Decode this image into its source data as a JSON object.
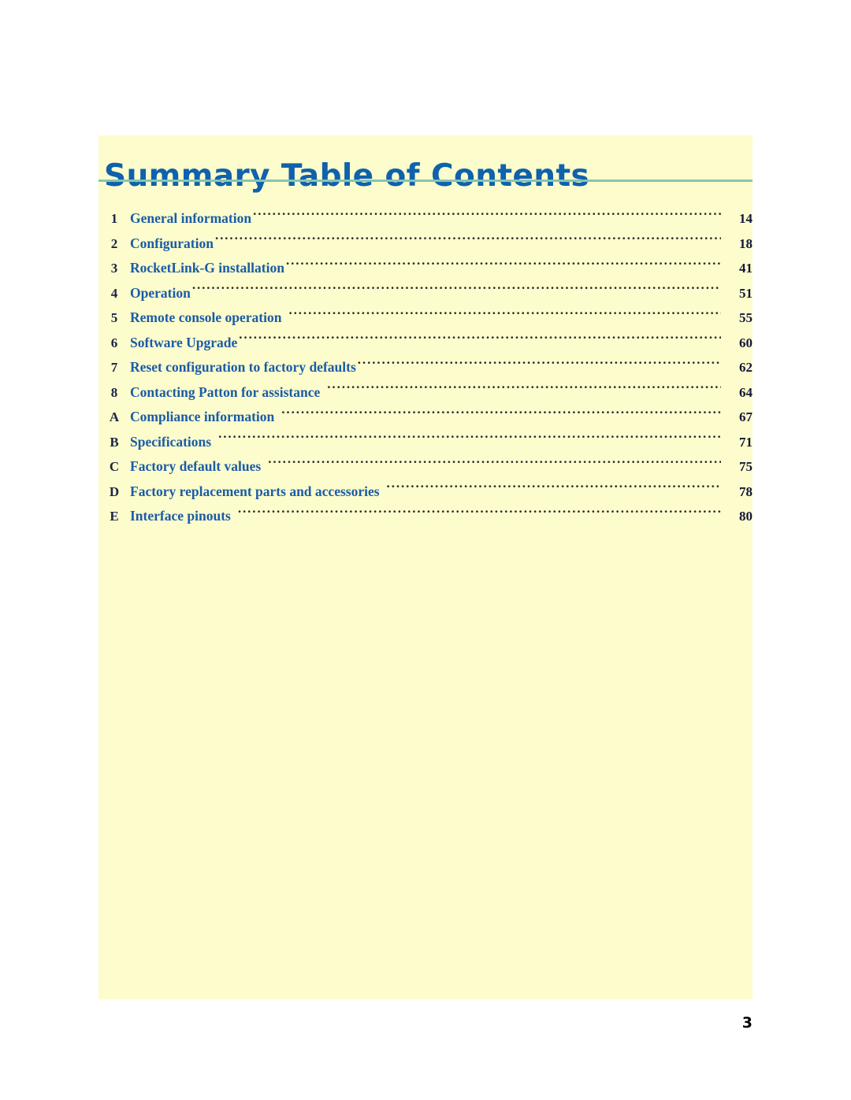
{
  "page": {
    "title": "Summary Table of Contents",
    "folio": "3",
    "background_color": "#ffffff",
    "panel_color": "#fdfccc",
    "title_color": "#0f62ab",
    "rule_color": "#86c5b1",
    "entry_color": "#1a5ca8",
    "number_color": "#1c2447"
  },
  "toc": {
    "entries": [
      {
        "number": "1",
        "label": "General information",
        "page": "14",
        "gap": false
      },
      {
        "number": "2",
        "label": "Configuration",
        "page": "18",
        "gap": false
      },
      {
        "number": "3",
        "label": "RocketLink-G installation",
        "page": "41",
        "gap": false
      },
      {
        "number": "4",
        "label": "Operation",
        "page": "51",
        "gap": false
      },
      {
        "number": "5",
        "label": "Remote console operation",
        "page": "55",
        "gap": true
      },
      {
        "number": "6",
        "label": "Software Upgrade",
        "page": "60",
        "gap": false
      },
      {
        "number": "7",
        "label": "Reset configuration to factory defaults",
        "page": "62",
        "gap": false
      },
      {
        "number": "8",
        "label": "Contacting Patton for assistance",
        "page": "64",
        "gap": true
      },
      {
        "number": "A",
        "label": "Compliance information",
        "page": "67",
        "gap": true
      },
      {
        "number": "B",
        "label": "Specifications",
        "page": "71",
        "gap": true
      },
      {
        "number": "C",
        "label": "Factory default values",
        "page": "75",
        "gap": true
      },
      {
        "number": "D",
        "label": "Factory replacement parts and accessories",
        "page": "78",
        "gap": true
      },
      {
        "number": "E",
        "label": "Interface pinouts",
        "page": "80",
        "gap": true
      }
    ]
  }
}
